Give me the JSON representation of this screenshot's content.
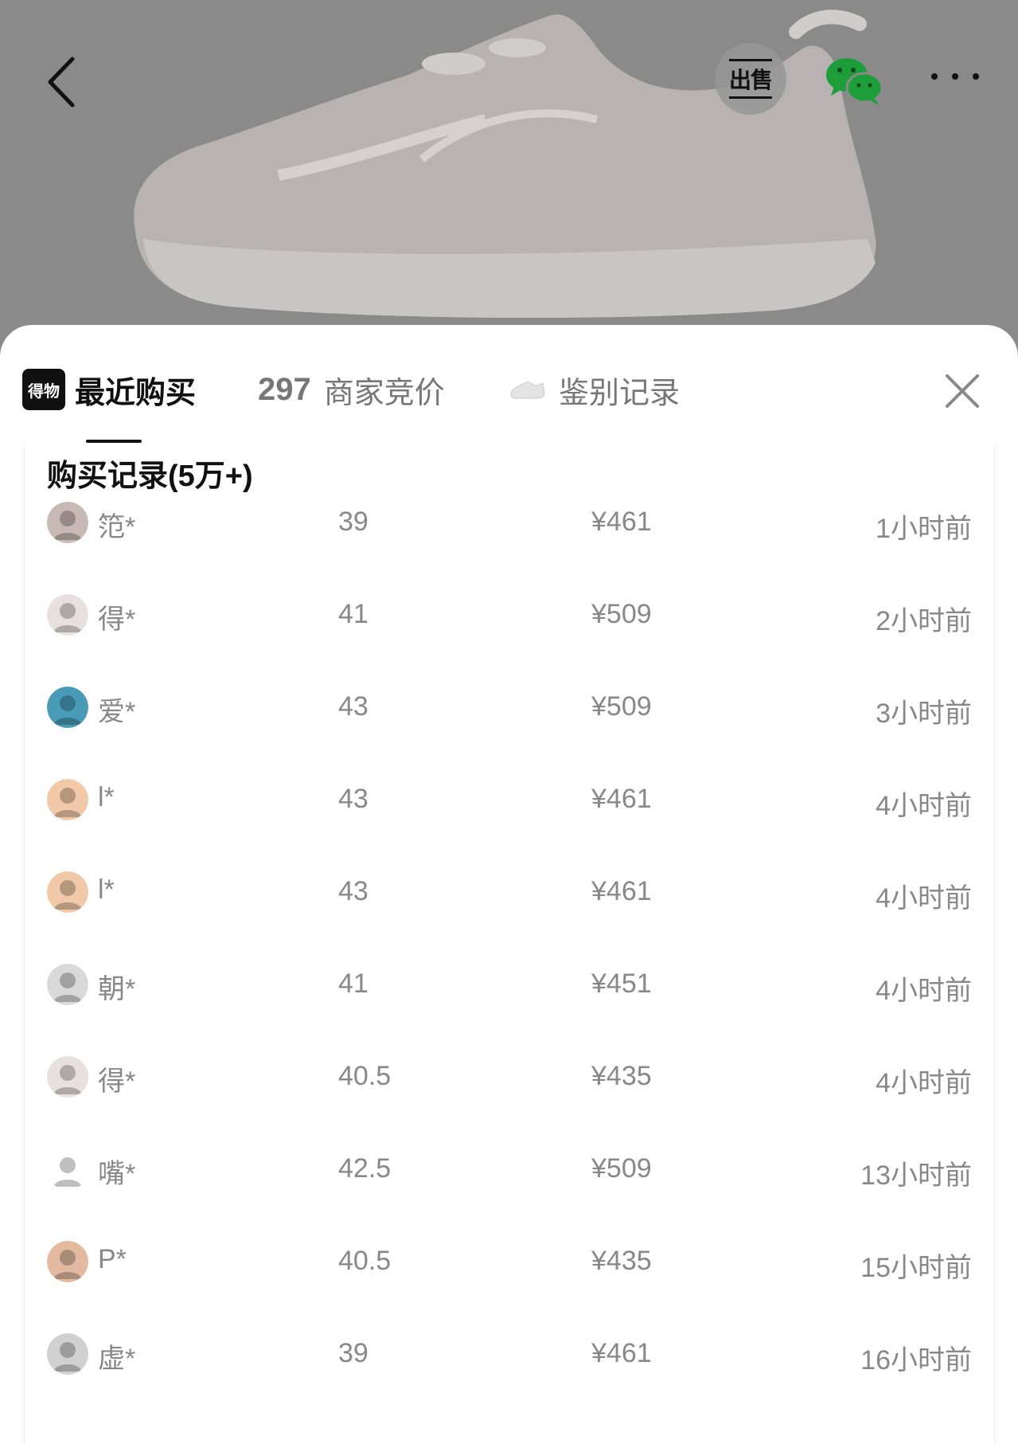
{
  "header": {
    "sell_label": "出售",
    "icons": {
      "back": "chevron-left-icon",
      "wechat": "wechat-icon",
      "more": "more-dots-icon"
    }
  },
  "tabs": {
    "recent": {
      "badge": "得物",
      "label": "最近购买"
    },
    "bids": {
      "count": "297",
      "label": "商家竞价"
    },
    "auth": {
      "label": "鉴别记录"
    }
  },
  "records": {
    "title": "购买记录(5万+)",
    "rows": [
      {
        "user": "笵*",
        "size": "39",
        "price": "¥461",
        "time": "1小时前",
        "avatar_color": "#c9b9b5"
      },
      {
        "user": "得*",
        "size": "41",
        "price": "¥509",
        "time": "2小时前",
        "avatar_color": "#e8e0e0"
      },
      {
        "user": "爱*",
        "size": "43",
        "price": "¥509",
        "time": "3小时前",
        "avatar_color": "#4a9bb8"
      },
      {
        "user": "l*",
        "size": "43",
        "price": "¥461",
        "time": "4小时前",
        "avatar_color": "#f2c9a8"
      },
      {
        "user": "l*",
        "size": "43",
        "price": "¥461",
        "time": "4小时前",
        "avatar_color": "#f2c9a8"
      },
      {
        "user": "朝*",
        "size": "41",
        "price": "¥451",
        "time": "4小时前",
        "avatar_color": "#d9d9d9"
      },
      {
        "user": "得*",
        "size": "40.5",
        "price": "¥435",
        "time": "4小时前",
        "avatar_color": "#e8e0e0"
      },
      {
        "user": "嘴*",
        "size": "42.5",
        "price": "¥509",
        "time": "13小时前",
        "avatar_color": "#ffffff"
      },
      {
        "user": "P*",
        "size": "40.5",
        "price": "¥435",
        "time": "15小时前",
        "avatar_color": "#e3b9a0"
      },
      {
        "user": "虚*",
        "size": "39",
        "price": "¥461",
        "time": "16小时前",
        "avatar_color": "#d0d0d0"
      }
    ]
  }
}
